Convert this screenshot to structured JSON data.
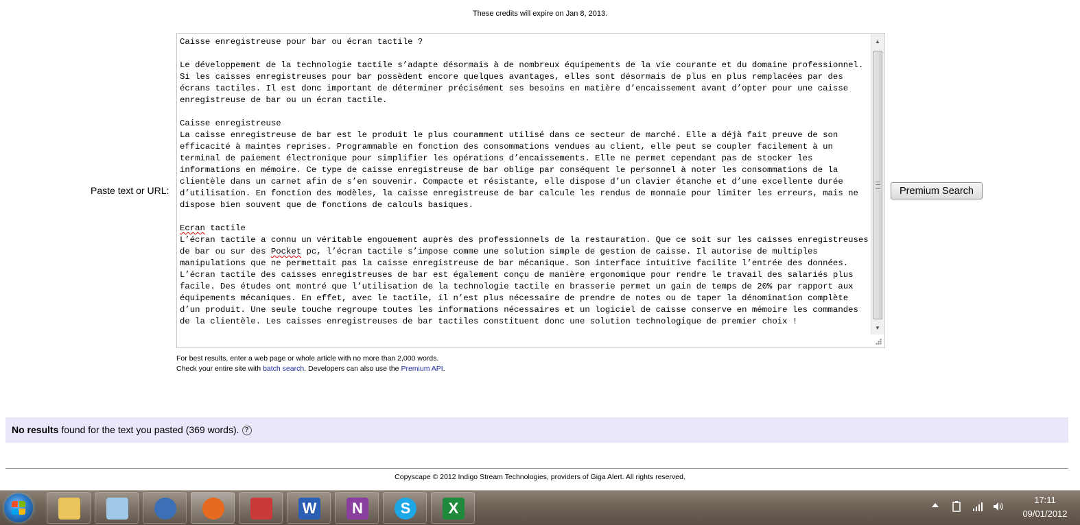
{
  "credits_notice": "These credits will expire on Jan 8, 2013.",
  "form": {
    "paste_label": "Paste text or URL:",
    "text_content": [
      "Caisse enregistreuse pour bar ou écran tactile ?",
      "",
      "Le développement de la technologie tactile s’adapte désormais à de nombreux équipements de la vie courante et du domaine professionnel. Si les caisses enregistreuses pour bar possèdent encore quelques avantages, elles sont désormais de plus en plus remplacées par des écrans tactiles. Il est donc important de déterminer précisément ses besoins en matière d’encaissement avant d’opter pour une caisse enregistreuse de bar ou un écran tactile.",
      "",
      "Caisse enregistreuse",
      "La caisse enregistreuse de bar est le produit le plus couramment utilisé dans ce secteur de marché. Elle a déjà fait preuve de son efficacité à maintes reprises. Programmable en fonction des consommations vendues au client, elle peut se coupler facilement à un terminal de paiement électronique pour simplifier les opérations d’encaissements. Elle ne permet cependant pas de stocker les informations en mémoire. Ce type de caisse enregistreuse de bar oblige par conséquent le personnel à noter les consommations de la clientèle dans un carnet afin de s’en souvenir. Compacte et résistante, elle dispose d’un clavier étanche et d’une excellente durée d’utilisation. En fonction des modèles, la caisse enregistreuse de bar calcule les rendus de monnaie pour limiter les erreurs, mais ne dispose bien souvent que de fonctions de calculs basiques.",
      "",
      "Ecran tactile",
      "L’écran tactile a connu un véritable engouement auprès des professionnels de la restauration. Que ce soit sur les caisses enregistreuses de bar ou sur des Pocket pc, l’écran tactile s’impose comme une solution simple de gestion de caisse. Il autorise de multiples manipulations que ne permettait pas la caisse enregistreuse de bar mécanique. Son interface intuitive facilite l’entrée des données. L’écran tactile des caisses enregistreuses de bar est également conçu de manière ergonomique pour rendre le travail des salariés plus facile. Des études ont montré que l’utilisation de la technologie tactile en brasserie permet un gain de temps de 20% par rapport aux équipements mécaniques. En effet, avec le tactile, il n’est plus nécessaire de prendre de notes ou de taper la dénomination complète d’un produit. Une seule touche regroupe toutes les informations nécessaires et un logiciel de caisse conserve en mémoire les commandes de la clientèle. Les caisses enregistreuses de bar tactiles constituent donc une solution technologique de premier choix !"
    ],
    "submit_label": "Premium Search",
    "hint_line1": "For best results, enter a web page or whole article with no more than 2,000 words.",
    "hint_line2_prefix": "Check your entire site with ",
    "batch_link": "batch search",
    "hint_line2_middle": ". Developers can also use the ",
    "api_link": "Premium API",
    "hint_line2_suffix": "."
  },
  "results": {
    "bold": "No results",
    "rest": " found for the text you pasted (369 words).",
    "help_glyph": "?"
  },
  "footer": "Copyscape © 2012 Indigo Stream Technologies, providers of Giga Alert. All rights reserved.",
  "taskbar": {
    "apps": [
      {
        "name": "windows-explorer",
        "icon": "folder-icon",
        "color": "#e9c45a"
      },
      {
        "name": "notepad",
        "icon": "notepad-icon",
        "color": "#9ec8e6"
      },
      {
        "name": "thunderbird",
        "icon": "mail-icon",
        "color": "#3b6fb6"
      },
      {
        "name": "firefox",
        "icon": "firefox-icon",
        "color": "#e66a1f"
      },
      {
        "name": "snipping-tool",
        "icon": "scissors-icon",
        "color": "#c93a3a"
      },
      {
        "name": "word",
        "icon": "word-icon",
        "color": "#2b5fb4",
        "letter": "W"
      },
      {
        "name": "onenote",
        "icon": "onenote-icon",
        "color": "#8a3f9e",
        "letter": "N"
      },
      {
        "name": "skype",
        "icon": "skype-icon",
        "color": "#1ea7e6",
        "letter": "S"
      },
      {
        "name": "excel",
        "icon": "excel-icon",
        "color": "#1f8a3c",
        "letter": "X"
      }
    ],
    "time": "17:11",
    "date": "09/01/2012"
  },
  "colors": {
    "results_bg": "#e8e8fa",
    "link": "#1a2a9c",
    "taskbar": "#6f6357"
  }
}
